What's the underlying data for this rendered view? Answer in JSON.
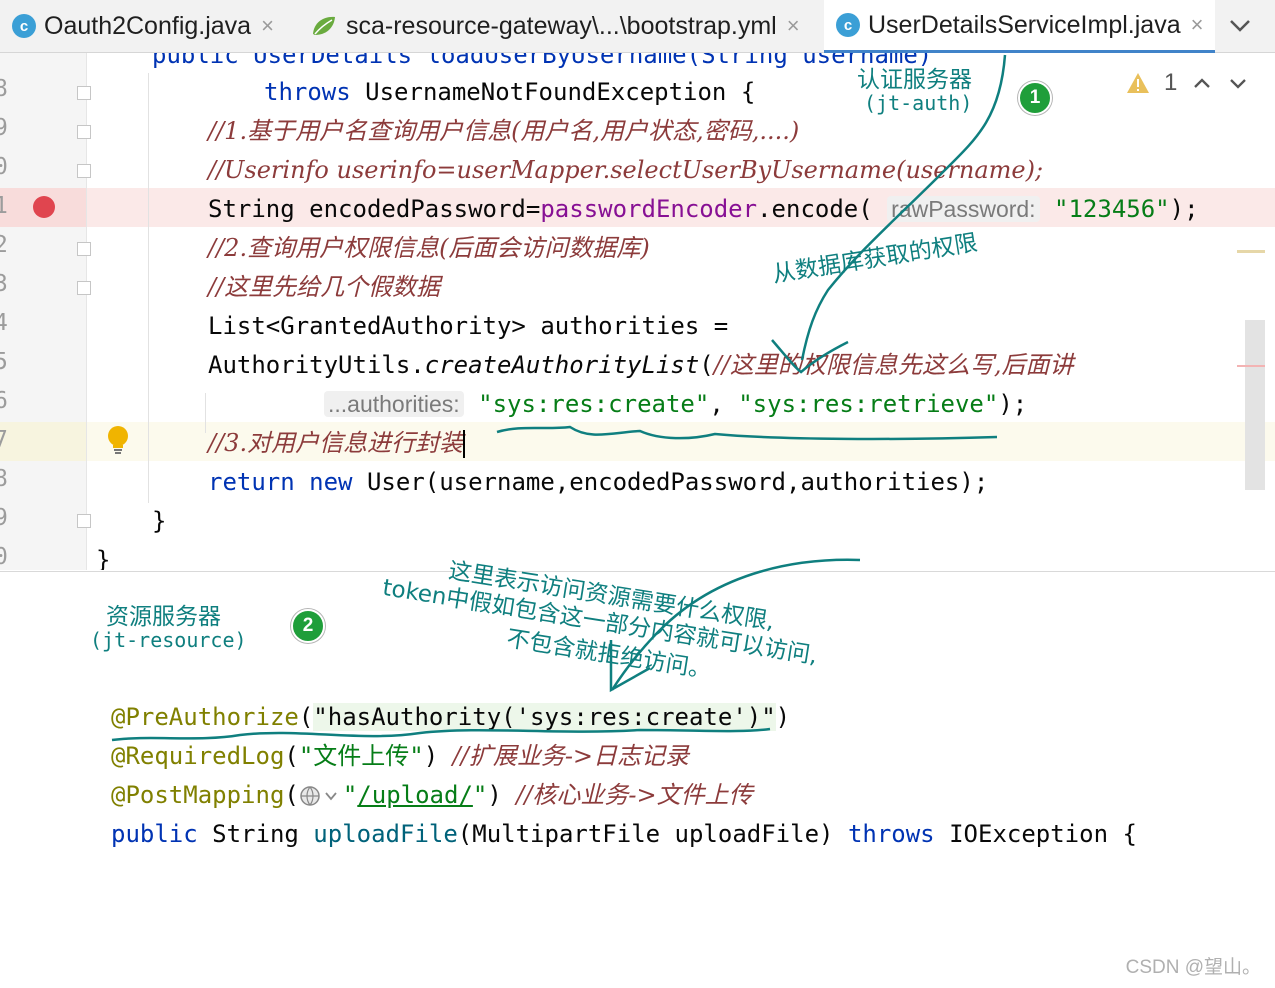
{
  "tabs": [
    {
      "label": "Oauth2Config.java",
      "icon": "class-icon",
      "active": false
    },
    {
      "label": "sca-resource-gateway\\...\\bootstrap.yml",
      "icon": "spring-leaf-icon",
      "active": false
    },
    {
      "label": "UserDetailsServiceImpl.java",
      "icon": "class-icon",
      "active": true
    }
  ],
  "tab_icon_letter": "c",
  "tab_close": "×",
  "editor": {
    "warning_count": "1",
    "line_numbers": [
      "8",
      "9",
      "0",
      "1",
      "2",
      "3",
      "4",
      "5",
      "6",
      "7",
      "8",
      "9",
      "0"
    ],
    "lines": {
      "l0": "public UserDetails loadUserByUsername(String username)",
      "l1_kw": "throws",
      "l1_rest": " UsernameNotFoundException {",
      "l2": "//1.基于用户名查询用户信息(用户名,用户状态,密码,....)",
      "l3": "//Userinfo userinfo=userMapper.selectUserByUsername(username);",
      "l4_a": "String encodedPassword=",
      "l4_field": "passwordEncoder",
      "l4_b": ".encode( ",
      "l4_hint": "rawPassword:",
      "l4_str": "\"123456\"",
      "l4_c": ");",
      "l5": "//2.查询用户权限信息(后面会访问数据库)",
      "l6": "//这里先给几个假数据",
      "l7": "List<GrantedAuthority> authorities =",
      "l8_a": "AuthorityUtils.",
      "l8_method": "createAuthorityList",
      "l8_b": "(",
      "l8_cm": "//这里的权限信息先这么写,后面讲",
      "l9_hint": "...authorities:",
      "l9_s1": "\"sys:res:create\"",
      "l9_mid": ", ",
      "l9_s2": "\"sys:res:retrieve\"",
      "l9_end": ");",
      "l10": "//3.对用户信息进行封装",
      "l11_kw1": "return",
      "l11_kw2": "new",
      "l11_rest": " User(username,encodedPassword,authorities);",
      "l12": "}",
      "l13": "}"
    }
  },
  "lower": {
    "a1_name": "@PreAuthorize",
    "a1_open": "(",
    "a1_arg": "\"hasAuthority('sys:res:create')\"",
    "a1_close": ")",
    "a2_name": "@RequiredLog",
    "a2_open": "(",
    "a2_str": "\"文件上传\"",
    "a2_close": ")",
    "a2_cm": "//扩展业务->日志记录",
    "a3_name": "@PostMapping",
    "a3_open": "(",
    "a3_q1": "\"",
    "a3_url": "/upload/",
    "a3_q2": "\"",
    "a3_close": ")",
    "a3_cm": "//核心业务->文件上传",
    "sig_kw1": "public",
    "sig_type": " String ",
    "sig_method": "uploadFile",
    "sig_params": "(MultipartFile uploadFile) ",
    "sig_kw2": "throws",
    "sig_rest": " IOException {"
  },
  "handwriting": {
    "auth_server": "认证服务器",
    "auth_server_sub": "(jt-auth)",
    "from_db": "从数据库获取的权限",
    "badge1": "1",
    "res_server": "资源服务器",
    "res_server_sub": "(jt-resource)",
    "badge2": "2",
    "note_line1": "这里表示访问资源需要什么权限,",
    "note_line2": "token中假如包含这一部分内容就可以访问,",
    "note_line3": "不包含就拒绝访问。"
  },
  "watermark": "CSDN @望山。",
  "colors": {
    "keyword": "#0033b3",
    "comment": "#8c3b3b",
    "string": "#067d17",
    "field": "#871094",
    "annotation": "#808000",
    "method": "#00627a",
    "handwriting": "#0f7f7f",
    "breakpoint": "#e0454f",
    "badge": "#1f9e3a"
  }
}
